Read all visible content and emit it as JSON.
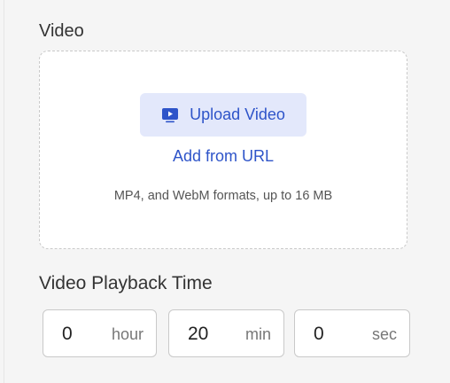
{
  "video_section": {
    "title": "Video",
    "upload_button_label": "Upload Video",
    "add_url_label": "Add from URL",
    "hint": "MP4, and WebM formats, up to 16 MB",
    "upload_icon": "video-play-icon"
  },
  "playback_section": {
    "title": "Video Playback Time",
    "fields": [
      {
        "value": "0",
        "unit": "hour"
      },
      {
        "value": "20",
        "unit": "min"
      },
      {
        "value": "0",
        "unit": "sec"
      }
    ]
  },
  "colors": {
    "accent": "#2e54c9",
    "button_bg": "#e3e8fb",
    "border": "#c9c9c9",
    "background": "#f5f5f5"
  }
}
